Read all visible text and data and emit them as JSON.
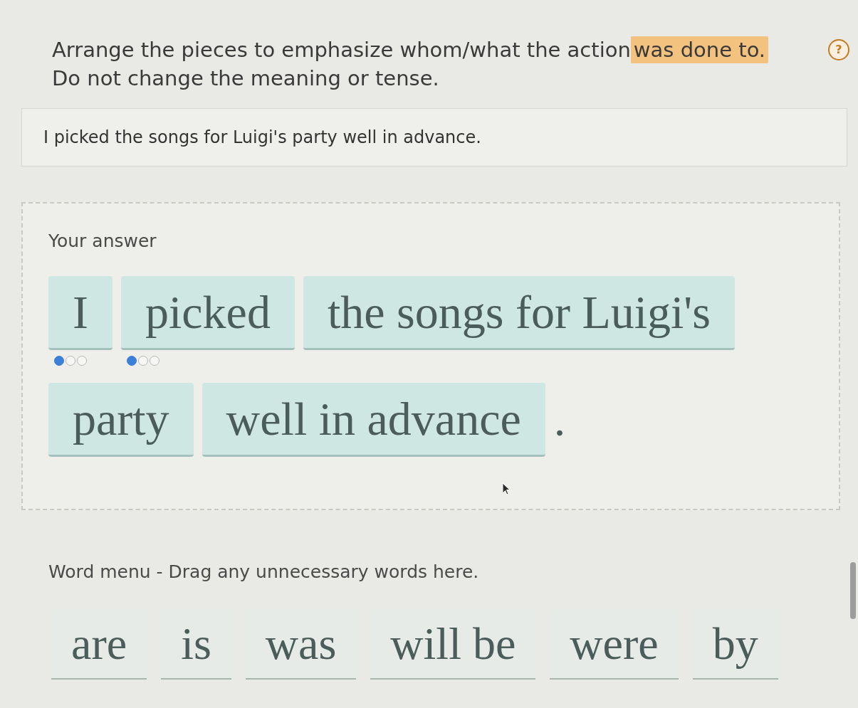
{
  "instructions": [
    {
      "segments": [
        {
          "text": "Arrange the pieces to emphasize whom/what the action",
          "highlighted": false
        },
        {
          "text": "was done to.",
          "highlighted": true
        }
      ]
    },
    {
      "segments": [
        {
          "text": "Do not change the meaning or tense.",
          "highlighted": false
        }
      ]
    }
  ],
  "help_button": {
    "label": "?"
  },
  "source_sentence": "I picked the songs for Luigi's party well in advance.",
  "answer": {
    "label": "Your answer",
    "pieces": [
      {
        "kind": "tile",
        "text": "I",
        "variants": [
          {
            "selected": true
          },
          {
            "selected": false
          },
          {
            "selected": false
          }
        ]
      },
      {
        "kind": "tile",
        "text": "picked",
        "variants": [
          {
            "selected": true
          },
          {
            "selected": false
          },
          {
            "selected": false
          }
        ]
      },
      {
        "kind": "tile",
        "text": "the songs for Luigi's"
      },
      {
        "kind": "tile",
        "text": "party"
      },
      {
        "kind": "tile",
        "text": "well in advance"
      },
      {
        "kind": "punctuation",
        "text": "."
      }
    ]
  },
  "word_menu": {
    "label": "Word menu - Drag any unnecessary words here.",
    "words": [
      "are",
      "is",
      "was",
      "will be",
      "were",
      "by"
    ]
  }
}
